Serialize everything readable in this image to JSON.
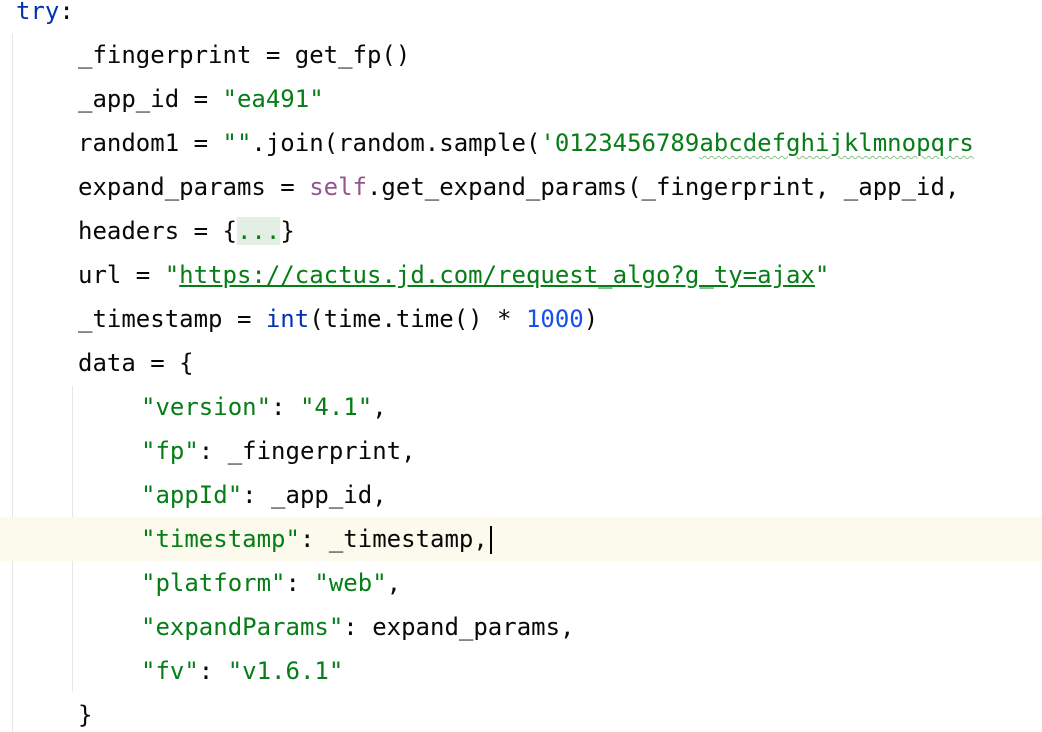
{
  "code": {
    "l0_kw": "try",
    "l0_colon": ":",
    "l1": "_fingerprint = get_fp()",
    "l2_pre": "_app_id = ",
    "l2_str": "\"ea491\"",
    "l3_pre": "random1 = ",
    "l3_str": "\"\"",
    "l3_mid": ".join(random.sample(",
    "l3_str2a": "'0123456789",
    "l3_str2b": "abcdefghijklmnopqrs",
    "l4_pre": "expand_params = ",
    "l4_self": "self",
    "l4_post": ".get_expand_params(_fingerprint, _app_id,",
    "l5_pre": "headers = {",
    "l5_fold": "...",
    "l5_post": "}",
    "l6_pre": "url = ",
    "l6_q1": "\"",
    "l6_link": "https://cactus.jd.com/request_algo?g_ty=ajax",
    "l6_q2": "\"",
    "l7_pre": "_timestamp = ",
    "l7_kw": "int",
    "l7_mid": "(time.time() * ",
    "l7_num": "1000",
    "l7_post": ")",
    "l8": "data = {",
    "l9_key": "\"version\"",
    "l9_colon": ": ",
    "l9_val": "\"4.1\"",
    "l9_comma": ",",
    "l10_key": "\"fp\"",
    "l10_post": ": _fingerprint,",
    "l11_key": "\"appId\"",
    "l11_post": ": _app_id,",
    "l12_key": "\"timestamp\"",
    "l12_post": ": _timestamp,",
    "l13_key": "\"platform\"",
    "l13_colon": ": ",
    "l13_val": "\"web\"",
    "l13_comma": ",",
    "l14_key": "\"expandParams\"",
    "l14_post": ": expand_params,",
    "l15_key": "\"fv\"",
    "l15_colon": ": ",
    "l15_val": "\"v1.6.1\"",
    "l16": "}"
  },
  "colors": {
    "keyword": "#0033b3",
    "string": "#067d17",
    "self": "#94558d",
    "number": "#1750eb",
    "text": "#080808",
    "current_line": "#fcfaed"
  }
}
